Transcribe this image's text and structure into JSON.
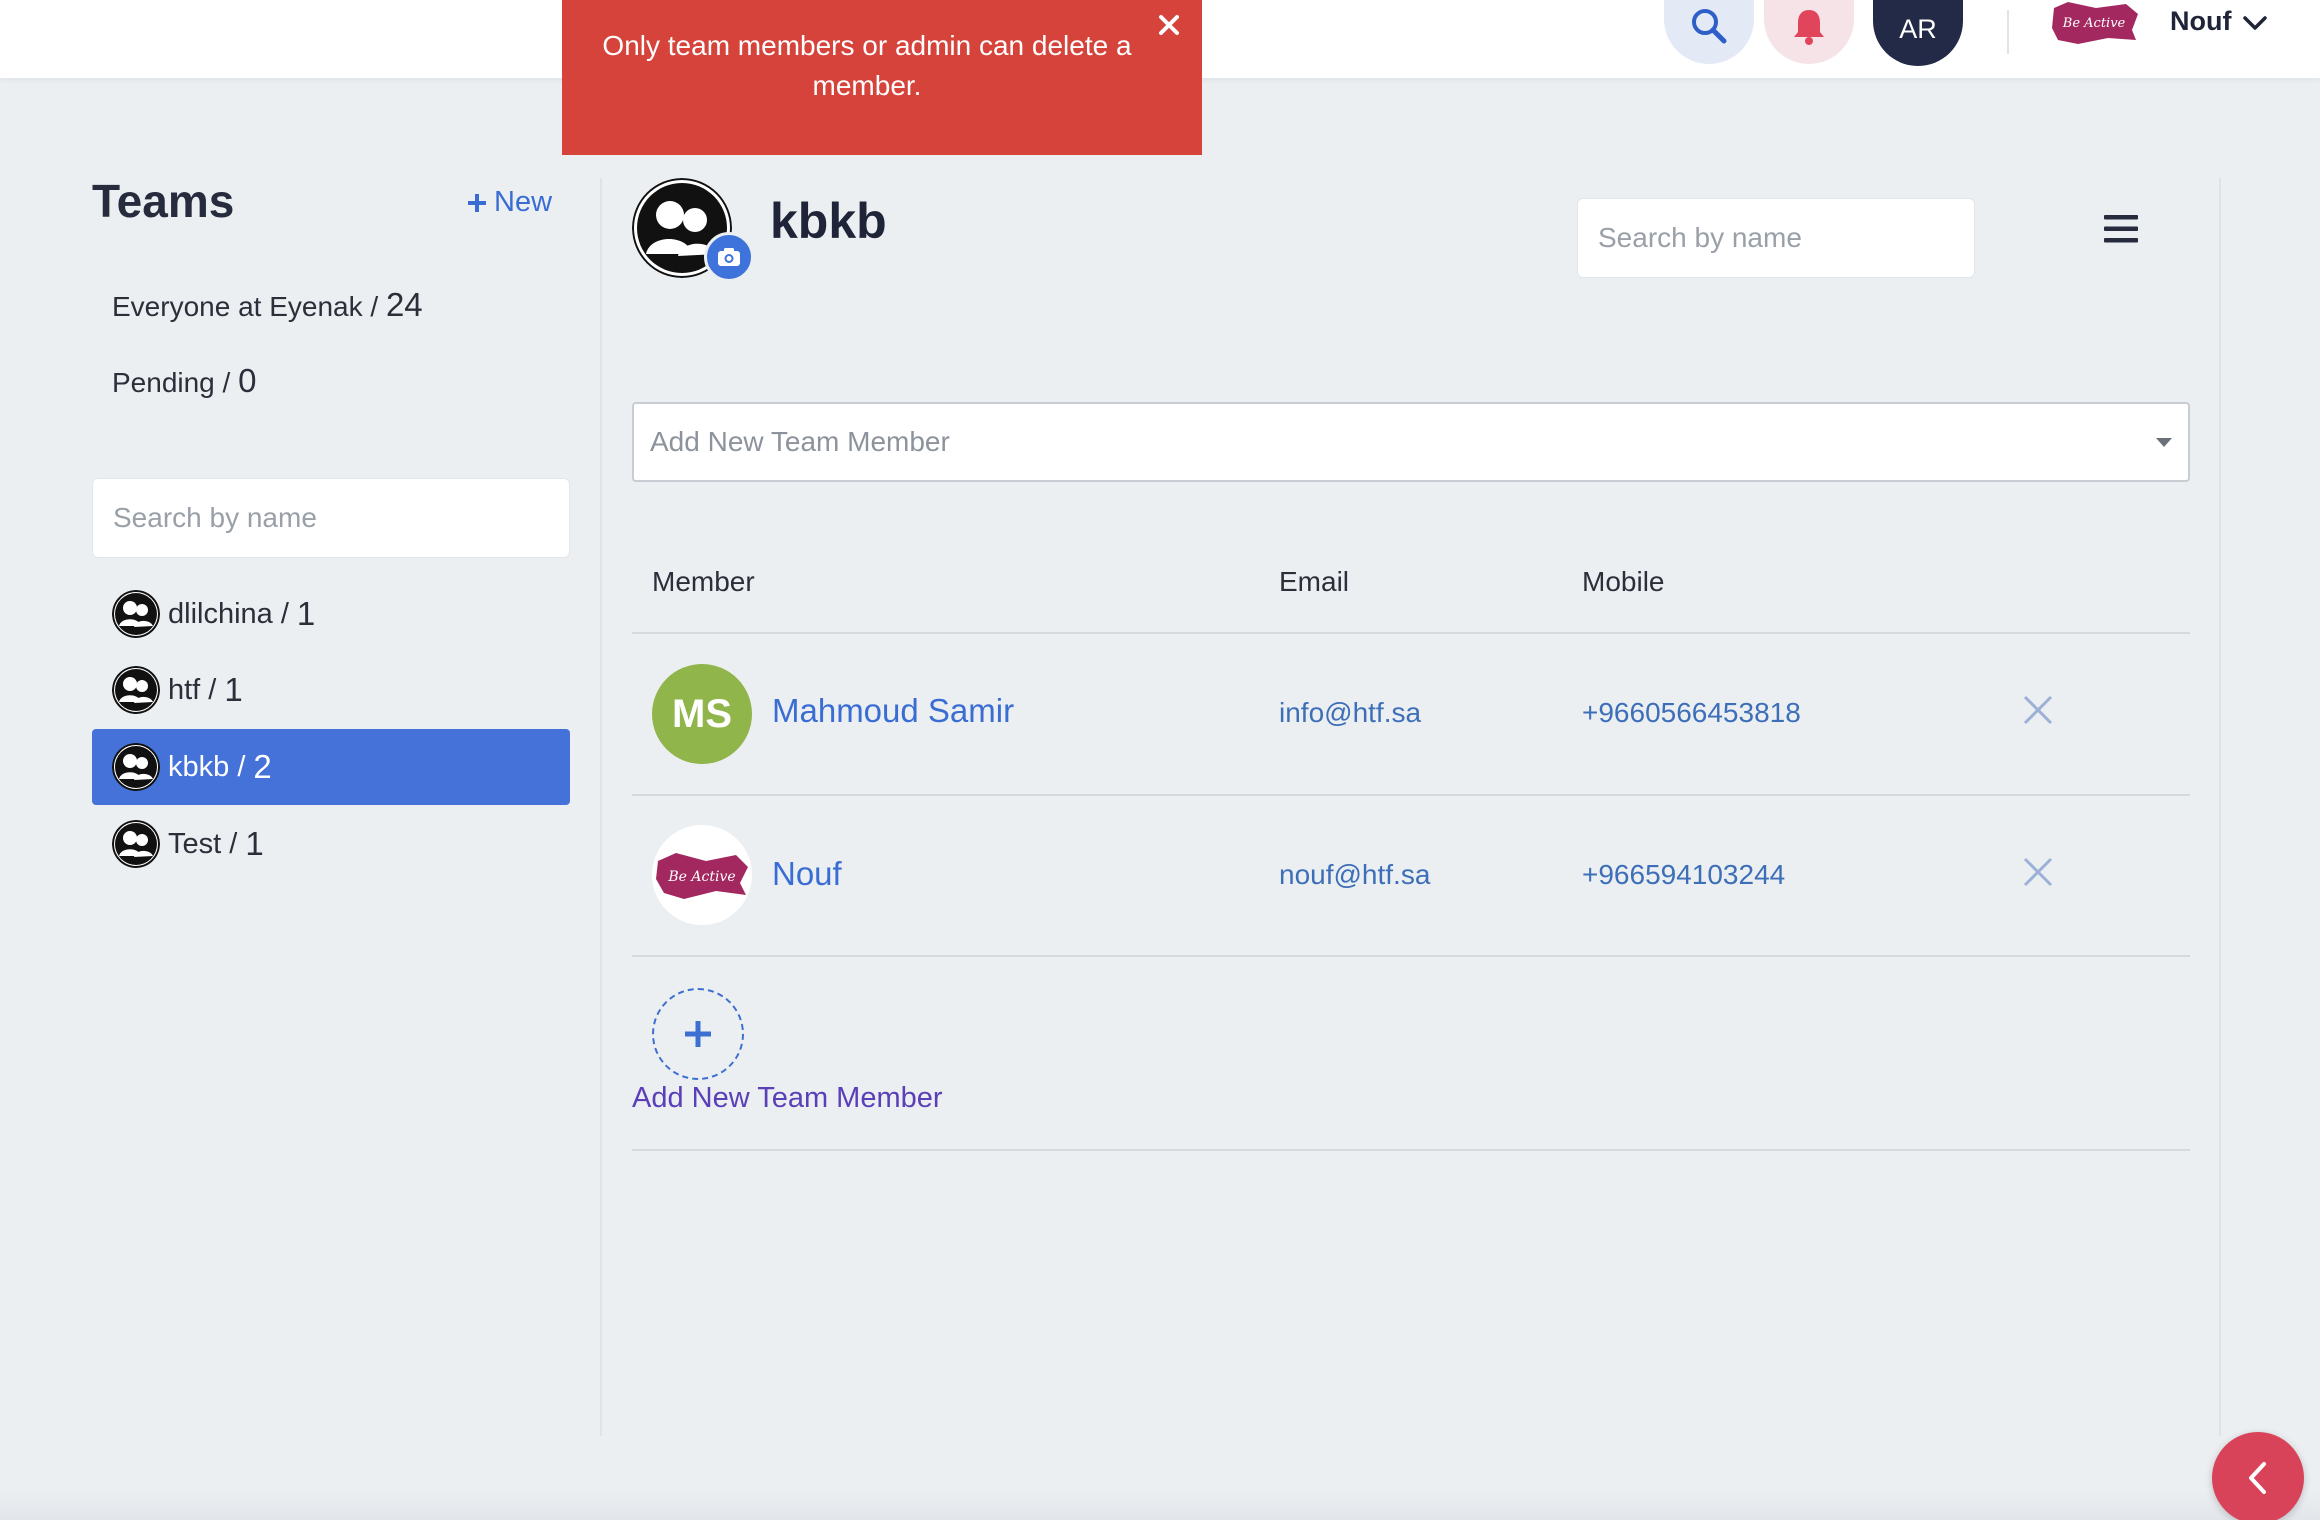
{
  "header": {
    "language_label": "AR",
    "user_name": "Nouf",
    "logo_text": "Be Active",
    "icons": [
      "search-icon",
      "bell-icon",
      "chevron-down-icon"
    ]
  },
  "toast": {
    "message": "Only team members or admin can delete a member."
  },
  "sidebar": {
    "title": "Teams",
    "new_label": "New",
    "filters": [
      {
        "label": "Everyone at Eyenak / ",
        "count": "24"
      },
      {
        "label": "Pending / ",
        "count": "0"
      }
    ],
    "search_placeholder": "Search by name",
    "teams": [
      {
        "name": "dlilchina / ",
        "count": "1"
      },
      {
        "name": "htf / ",
        "count": "1"
      },
      {
        "name": "kbkb / ",
        "count": "2"
      },
      {
        "name": "Test / ",
        "count": "1"
      }
    ]
  },
  "main": {
    "team_name": "kbkb",
    "search_placeholder": "Search by name",
    "add_member_placeholder": "Add New Team Member",
    "columns": [
      "Member",
      "Email",
      "Mobile"
    ],
    "members": [
      {
        "initials": "MS",
        "name": "Mahmoud Samir",
        "email": "info@htf.sa",
        "mobile": "+9660566453818"
      },
      {
        "initials": "",
        "name": "Nouf",
        "email": "nouf@htf.sa",
        "mobile": "+966594103244",
        "avatar_logo_text": "Be Active"
      }
    ],
    "add_member_label": "Add New Team Member"
  },
  "colors": {
    "accent": "#4472d8",
    "toast": "#d5433b",
    "fab": "#d9435a",
    "ms_avatar": "#8fb54b",
    "brand_logo": "#a3285f"
  }
}
